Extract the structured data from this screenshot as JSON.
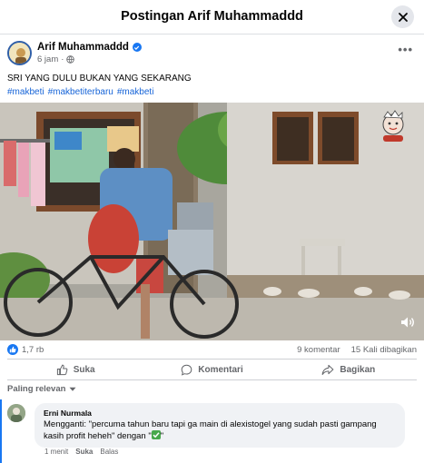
{
  "header": {
    "title": "Postingan Arif Muhammaddd"
  },
  "post": {
    "author": "Arif Muhammaddd",
    "time": "6 jam",
    "caption": "SRI YANG DULU BUKAN YANG SEKARANG",
    "hashtags": [
      "#makbeti",
      "#makbetiterbaru",
      "#makbeti"
    ]
  },
  "stats": {
    "likes": "1,7 rb",
    "comments": "9 komentar",
    "shares": "15 Kali dibagikan"
  },
  "actions": {
    "like": "Suka",
    "comment": "Komentari",
    "share": "Bagikan"
  },
  "sort": {
    "label": "Paling relevan"
  },
  "comment": {
    "author": "Erni Nurmala",
    "text": "Mengganti: \"percuma tahun baru tapi ga main di alexistogel yang sudah pasti gampang kasih profit heheh\" dengan \"",
    "text_end": "\"",
    "time": "1 menit",
    "like": "Suka",
    "reply": "Balas"
  },
  "colors": {
    "accent": "#1877f2",
    "secondary_text": "#65676b",
    "link": "#1664d8"
  },
  "icons": [
    "close-icon",
    "verified-icon",
    "globe-icon",
    "more-icon",
    "volume-icon",
    "like-icon",
    "comment-icon",
    "share-icon",
    "chevron-down-icon",
    "check-emoji"
  ]
}
